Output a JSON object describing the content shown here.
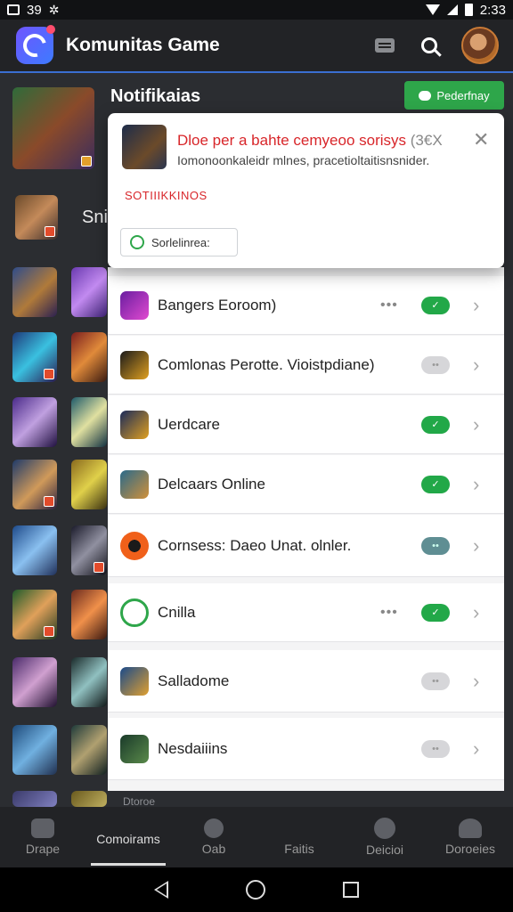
{
  "status_bar": {
    "time_left": "39",
    "time_right": "2:33"
  },
  "header": {
    "title": "Komunitas Game"
  },
  "background": {
    "heading": "Notifikaias",
    "snippet": "Sni",
    "green_button": "Pederfnay"
  },
  "popup": {
    "title": "Dloe per a bahte cemyeoo sorisys",
    "title_suffix": "(3€X",
    "subtitle": "Iomonoonkaleidr mlnes, pracetioltaitisnsnider.",
    "section": "SOTIIIKKINOS",
    "button_label": "Sorlelinrea:"
  },
  "rows": [
    {
      "name": "Bangers Eoroom)",
      "dots": true,
      "toggle": "on"
    },
    {
      "name": "Comlonas Perotte. Vioistpdiane)",
      "dots": false,
      "toggle": "off"
    },
    {
      "name": "Uerdcare",
      "dots": false,
      "toggle": "on"
    },
    {
      "name": "Delcaars Online",
      "dots": false,
      "toggle": "on"
    },
    {
      "name": "Cornsess: Daeo Unat. olnler.",
      "dots": false,
      "toggle": "teal"
    },
    {
      "name": "Cnilla",
      "dots": true,
      "toggle": "on"
    },
    {
      "name": "Salladome",
      "dots": false,
      "toggle": "off"
    },
    {
      "name": "Nesdaiiins",
      "dots": false,
      "toggle": "off"
    }
  ],
  "bottom_nav": {
    "peek_label": "Dtoroe",
    "items": [
      "Drape",
      "Comoirams",
      "Oab",
      "Faitis",
      "Deicioi",
      "Doroeies"
    ]
  },
  "colors": {
    "accent_green": "#22a848",
    "alert_red": "#d8262a",
    "brand": "#5b5cff"
  }
}
